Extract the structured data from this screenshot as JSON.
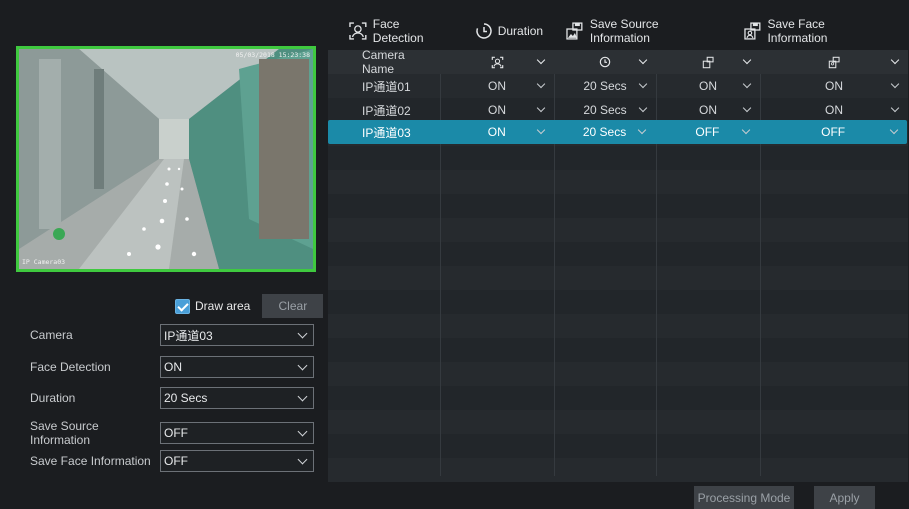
{
  "legend": {
    "face_detection": "Face Detection",
    "duration": "Duration",
    "save_source": "Save Source Information",
    "save_face": "Save Face Information"
  },
  "preview": {
    "timestamp": "05/03/2018 15:23:38",
    "camera_label": "IP Camera03"
  },
  "draw_area": {
    "label": "Draw area",
    "checked": true,
    "clear_label": "Clear"
  },
  "form": {
    "camera": {
      "label": "Camera",
      "value": "IP通道03"
    },
    "face_detection": {
      "label": "Face Detection",
      "value": "ON"
    },
    "duration": {
      "label": "Duration",
      "value": "20 Secs"
    },
    "save_source": {
      "label": "Save Source Information",
      "value": "OFF"
    },
    "save_face": {
      "label": "Save Face Information",
      "value": "OFF"
    }
  },
  "table": {
    "header": {
      "camera_name": "Camera Name"
    },
    "rows": [
      {
        "name": "IP通道01",
        "face_detection": "ON",
        "duration": "20 Secs",
        "save_source": "ON",
        "save_face": "ON",
        "selected": false
      },
      {
        "name": "IP通道02",
        "face_detection": "ON",
        "duration": "20 Secs",
        "save_source": "ON",
        "save_face": "ON",
        "selected": false
      },
      {
        "name": "IP通道03",
        "face_detection": "ON",
        "duration": "20 Secs",
        "save_source": "OFF",
        "save_face": "OFF",
        "selected": true
      }
    ]
  },
  "buttons": {
    "processing_mode": "Processing Mode",
    "apply": "Apply"
  },
  "colors": {
    "selected_row": "#1b8aa8",
    "area_border": "#3fc93f",
    "checkbox": "#4a9fd8"
  }
}
